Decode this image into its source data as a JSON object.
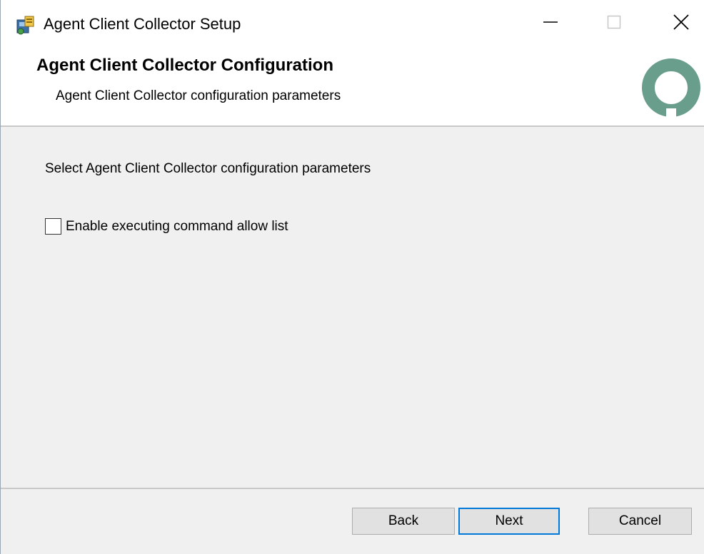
{
  "window": {
    "title": "Agent Client Collector Setup",
    "icon": "installer-icon",
    "controls": {
      "minimize": "minimize-icon",
      "maximize": "maximize-icon",
      "close": "close-icon"
    }
  },
  "banner": {
    "title": "Agent Client Collector Configuration",
    "subtitle": "Agent Client Collector configuration parameters",
    "logo": "brand-logo-icon",
    "logo_color": "#6a9e8c"
  },
  "main": {
    "instruction": "Select Agent Client Collector configuration parameters",
    "options": [
      {
        "label": "Enable executing command allow list",
        "checked": false
      }
    ]
  },
  "footer": {
    "back_label": "Back",
    "next_label": "Next",
    "cancel_label": "Cancel",
    "default_button_border": "#0078d7"
  }
}
